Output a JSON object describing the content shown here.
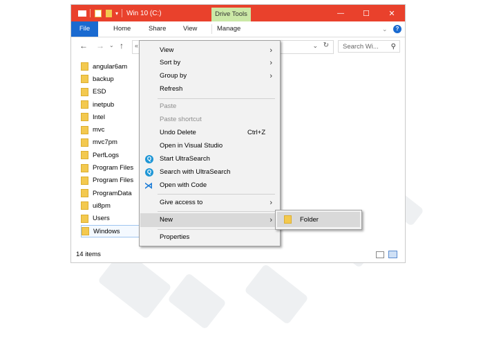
{
  "window": {
    "title": "Win 10 (C:)",
    "context_tab": "Drive Tools",
    "controls": {
      "minimize": "—",
      "maximize": "☐",
      "close": "✕"
    }
  },
  "ribbon": {
    "tabs": [
      "File",
      "Home",
      "Share",
      "View",
      "Manage"
    ],
    "help": "?"
  },
  "nav": {
    "back": "←",
    "forward": "→",
    "up": "↑",
    "address_prefix": "«",
    "search_placeholder": "Search Wi..."
  },
  "files": [
    "angular6am",
    "backup",
    "ESD",
    "inetpub",
    "Intel",
    "mvc",
    "mvc7pm",
    "PerfLogs",
    "Program Files",
    "Program Files",
    "ProgramData",
    "ui8pm",
    "Users",
    "Windows"
  ],
  "status": {
    "items": "14 items"
  },
  "context_menu": {
    "items": [
      {
        "label": "View"
      },
      {
        "label": "Sort by"
      },
      {
        "label": "Group by"
      },
      {
        "label": "Refresh"
      },
      {
        "label": "Paste"
      },
      {
        "label": "Paste shortcut"
      },
      {
        "label": "Undo Delete",
        "shortcut": "Ctrl+Z"
      },
      {
        "label": "Open in Visual Studio"
      },
      {
        "label": "Start UltraSearch"
      },
      {
        "label": "Search with UltraSearch"
      },
      {
        "label": "Open with Code"
      },
      {
        "label": "Give access to"
      },
      {
        "label": "New"
      },
      {
        "label": "Properties"
      }
    ]
  },
  "submenu": {
    "items": [
      {
        "label": "Folder"
      }
    ]
  },
  "colors": {
    "titlebar": "#e9412c",
    "file_tab": "#1a6ad0",
    "drive_tools": "#cbe8a6",
    "folder": "#f3c94f"
  }
}
